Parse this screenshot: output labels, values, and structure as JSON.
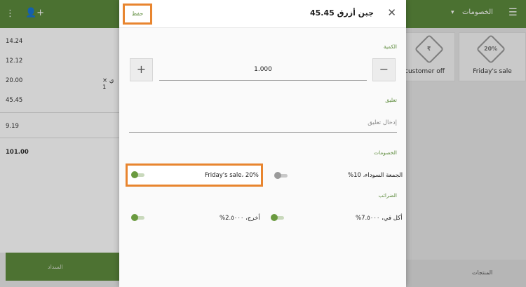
{
  "background": {
    "nav_title": "الخصومات",
    "receipt_lines": [
      "14.24",
      "12.12",
      "20.00",
      "45.45",
      "9.19"
    ],
    "receipt_item_fragment": "ي × 1",
    "receipt_total": "101.00",
    "pay_button_label": "السداد",
    "discount_tiles": [
      {
        "label": "Friday's sale",
        "tag": "20%"
      },
      {
        "label": "customer off",
        "tag": "₹"
      }
    ],
    "bottom_tab_label": "المنتجات"
  },
  "modal": {
    "save_label": "حفظ",
    "title": "جبن أزرق 45.45",
    "quantity_label": "الكمية",
    "quantity_value": "1.000",
    "decrease_symbol": "−",
    "increase_symbol": "+",
    "comment_label": "تعليق",
    "comment_placeholder": "إدخال تعليق",
    "discounts_label": "الخصومات",
    "discounts": [
      {
        "label": "الجمعة السوداء، 10%",
        "enabled": false
      },
      {
        "label": "Friday's sale، 20%",
        "enabled": true
      }
    ],
    "taxes_label": "الضرائب",
    "taxes": [
      {
        "label": "أكل في، 7.٥٠٠٠%",
        "enabled": true
      },
      {
        "label": "أخرج، 2.٥٠٠٠%",
        "enabled": true
      }
    ]
  },
  "colors": {
    "brand_green": "#5c8a3c",
    "highlight_orange": "#e8852f"
  }
}
